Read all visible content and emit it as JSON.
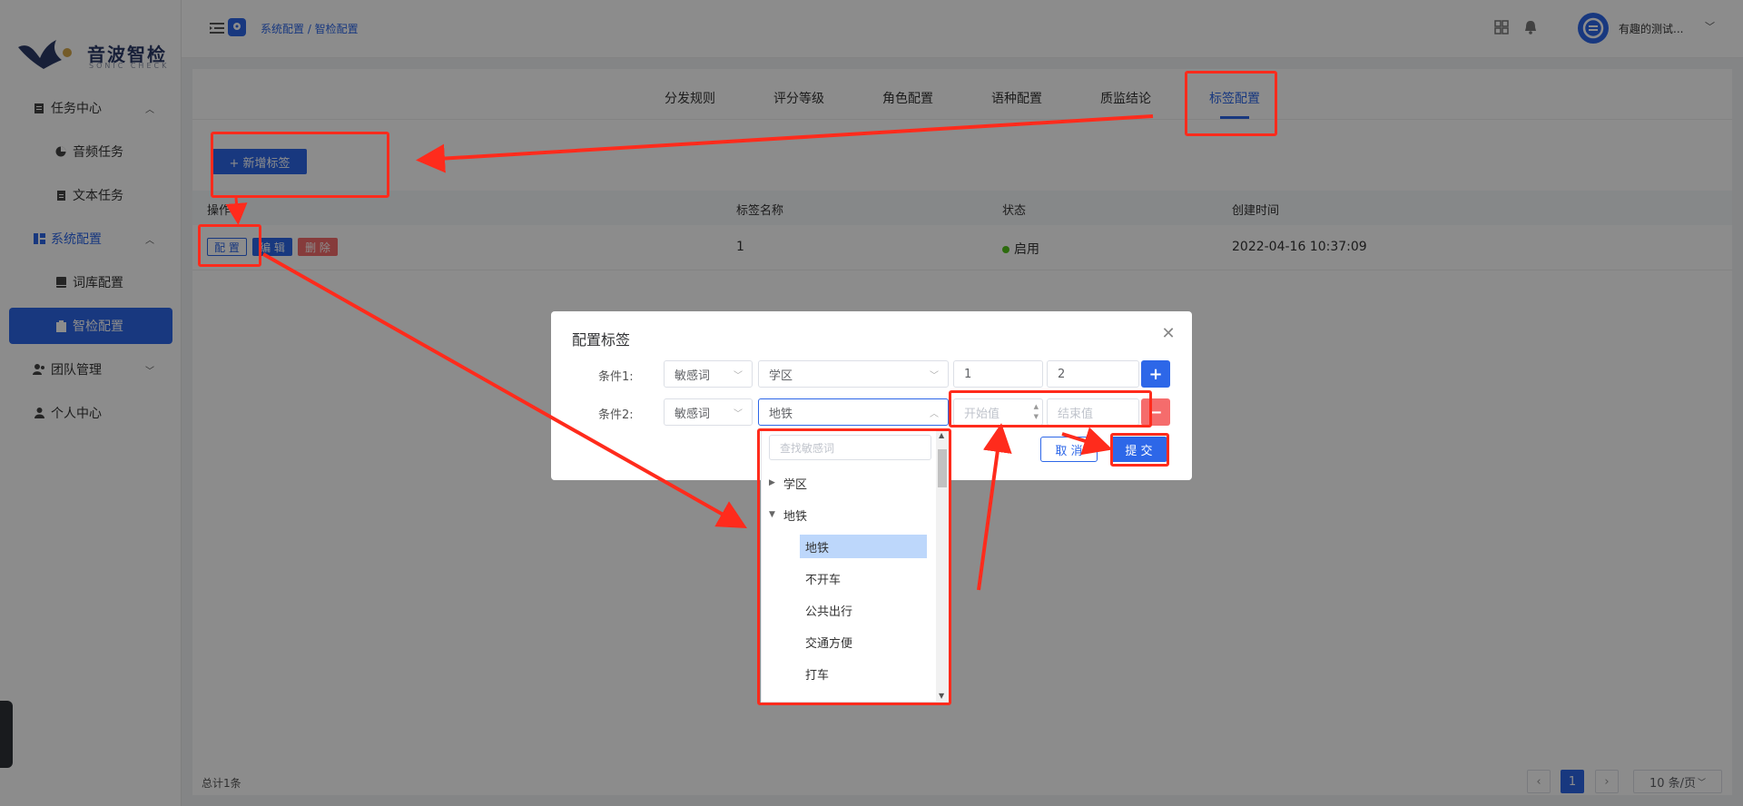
{
  "sidebar": {
    "logo_text": "音波智检",
    "logo_sub": "SONIC CHECK",
    "items": [
      {
        "label": "任务中心"
      },
      {
        "label": "音频任务"
      },
      {
        "label": "文本任务"
      },
      {
        "label": "系统配置"
      },
      {
        "label": "词库配置"
      },
      {
        "label": "智检配置"
      },
      {
        "label": "团队管理"
      },
      {
        "label": "个人中心"
      }
    ]
  },
  "header": {
    "breadcrumb": "系统配置 / 智检配置",
    "user_name": "有趣的测试..."
  },
  "tabs": [
    {
      "label": "分发规则"
    },
    {
      "label": "评分等级"
    },
    {
      "label": "角色配置"
    },
    {
      "label": "语种配置"
    },
    {
      "label": "质监结论"
    },
    {
      "label": "标签配置"
    }
  ],
  "toolbar": {
    "add_label": "+ 新增标签"
  },
  "table": {
    "headers": [
      "操作",
      "标签名称",
      "状态",
      "创建时间"
    ],
    "rows": [
      {
        "actions": [
          "配 置",
          "编 辑",
          "删 除"
        ],
        "name": "1",
        "status": "启用",
        "created": "2022-04-16 10:37:09"
      }
    ]
  },
  "footer": {
    "total": "总计1条",
    "page_current": "1",
    "page_size": "10 条/页"
  },
  "dialog": {
    "title": "配置标签",
    "conditions": [
      {
        "label": "条件1:",
        "type": "敏感词",
        "word": "学区",
        "start": "1",
        "end": "2",
        "action": "+"
      },
      {
        "label": "条件2:",
        "type": "敏感词",
        "word": "地铁",
        "start_placeholder": "开始值",
        "end_placeholder": "结束值",
        "action": "−"
      }
    ],
    "cancel_label": "取 消",
    "submit_label": "提 交"
  },
  "dropdown": {
    "search_placeholder": "查找敏感词",
    "nodes": [
      {
        "label": "学区"
      },
      {
        "label": "地铁"
      },
      {
        "label": "地铁"
      },
      {
        "label": "不开车"
      },
      {
        "label": "公共出行"
      },
      {
        "label": "交通方便"
      },
      {
        "label": "打车"
      }
    ]
  },
  "colors": {
    "primary": "#2d67e8",
    "danger": "#f56c6c",
    "annotation": "#ff2b1c",
    "status_on": "#52c41a"
  }
}
